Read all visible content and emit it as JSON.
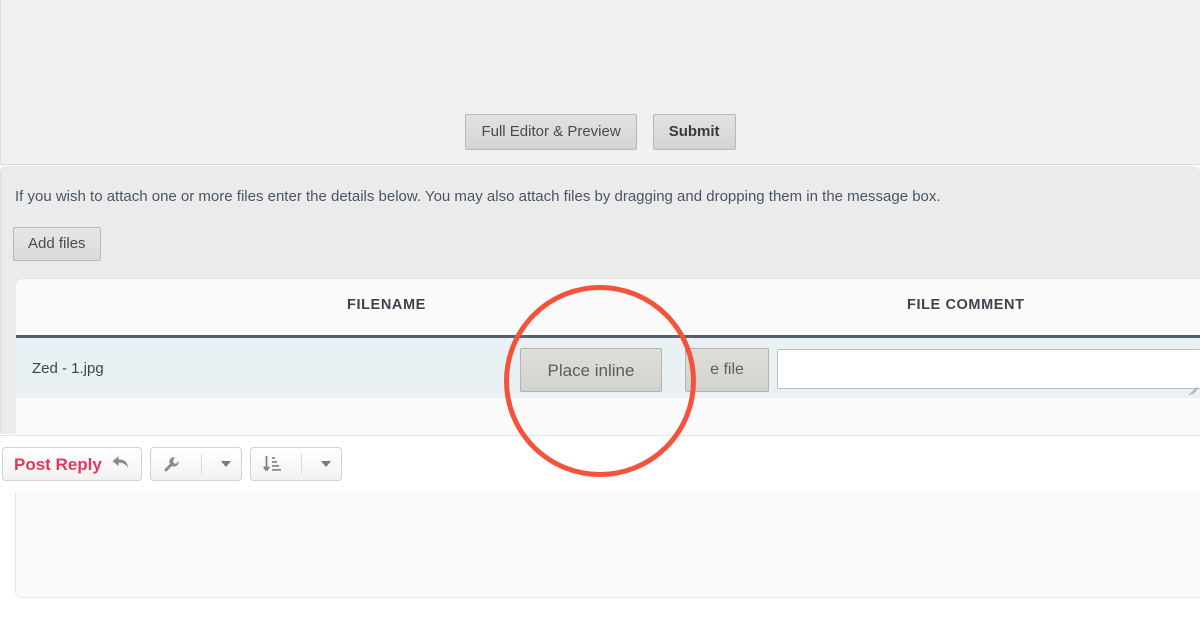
{
  "editor": {
    "full_editor_label": "Full Editor & Preview",
    "submit_label": "Submit"
  },
  "attach": {
    "note": "If you wish to attach one or more files enter the details below. You may also attach files by dragging and dropping them in the message box.",
    "add_files_label": "Add files"
  },
  "file_table": {
    "headers": {
      "filename": "FILENAME",
      "file_comment": "FILE COMMENT"
    },
    "rows": [
      {
        "filename": "Zed - 1.jpg",
        "place_inline_label": "Place inline",
        "delete_label": "e file",
        "comment_value": "",
        "comment_placeholder": ""
      }
    ]
  },
  "toolbar": {
    "post_reply_label": "Post Reply",
    "reply_icon": "reply-arrow-icon",
    "tools_icon": "wrench-icon",
    "sort_icon": "sort-descending-icon",
    "caret_icon": "chevron-down-icon"
  },
  "annotation": {
    "shape": "circle-highlight",
    "color": "#f5523c"
  }
}
